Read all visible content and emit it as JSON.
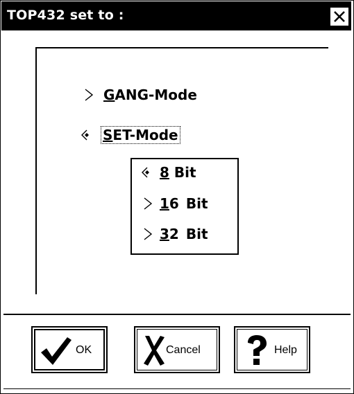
{
  "window": {
    "title": "TOP432 set to :",
    "close_icon": "close-x-icon"
  },
  "mode_options": [
    {
      "key": "G",
      "rest": "ANG-Mode",
      "selected": false,
      "icon": "chevron-right-icon"
    },
    {
      "key": "S",
      "rest": "ET-Mode",
      "selected": true,
      "icon": "diamond-selected-icon"
    }
  ],
  "bit_options": [
    {
      "key": "8",
      "rest": "Bit",
      "selected": true,
      "icon": "diamond-selected-icon"
    },
    {
      "key": "1",
      "rest2": "6",
      "rest": "Bit",
      "selected": false,
      "icon": "chevron-right-icon"
    },
    {
      "key": "3",
      "rest2": "2",
      "rest": "Bit",
      "selected": false,
      "icon": "chevron-right-icon"
    }
  ],
  "buttons": {
    "ok": {
      "label": "OK",
      "icon": "checkmark-icon"
    },
    "cancel": {
      "label": "Cancel",
      "icon": "x-cross-icon"
    },
    "help": {
      "label": "Help",
      "icon": "question-mark-icon"
    }
  }
}
